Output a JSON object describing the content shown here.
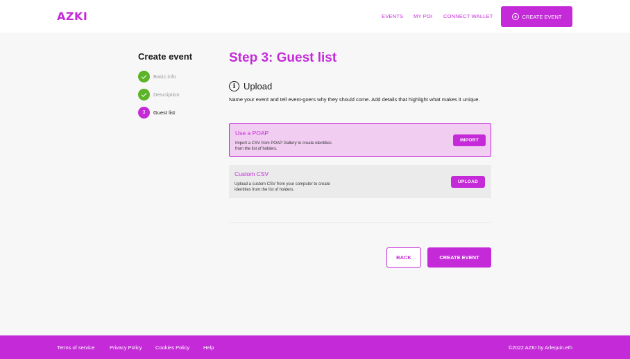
{
  "header": {
    "logo": "AZKI",
    "nav": [
      "EVENTS",
      "MY POI",
      "CONNECT WALLET"
    ],
    "cta_label": "CREATE EVENT"
  },
  "sidebar": {
    "title": "Create event",
    "steps": [
      {
        "label": "Basic info",
        "status": "done"
      },
      {
        "label": "Description",
        "status": "done"
      },
      {
        "label": "Guest list",
        "status": "current",
        "number": "3"
      }
    ]
  },
  "main": {
    "title": "Step 3: Guest list",
    "section_icon": "info-icon",
    "section_title": "Upload",
    "section_description": "Name your event and tell event-goers why they should come. Add details that highlight what makes it unique.",
    "cards": [
      {
        "title": "Use a POAP",
        "description": "Import a CSV from POAP Gallery to create identities from the list of holders.",
        "button": "IMPORT"
      },
      {
        "title": "Custom CSV",
        "description": "Upload a custom CSV from your computer to create identities from the list of holders.",
        "button": "UPLOAD"
      }
    ],
    "back_label": "BACK",
    "create_label": "CREATE EVENT"
  },
  "footer": {
    "links": [
      "Terms of service",
      "Privacy Policy",
      "Cookies Policy",
      "Help"
    ],
    "copyright": "©2022 AZKI by Arlequin.eth"
  },
  "colors": {
    "accent": "#c42ad8",
    "step_done": "#5cb327",
    "card_selected_bg": "#f2cdf2",
    "card_bg": "#ebebeb"
  }
}
